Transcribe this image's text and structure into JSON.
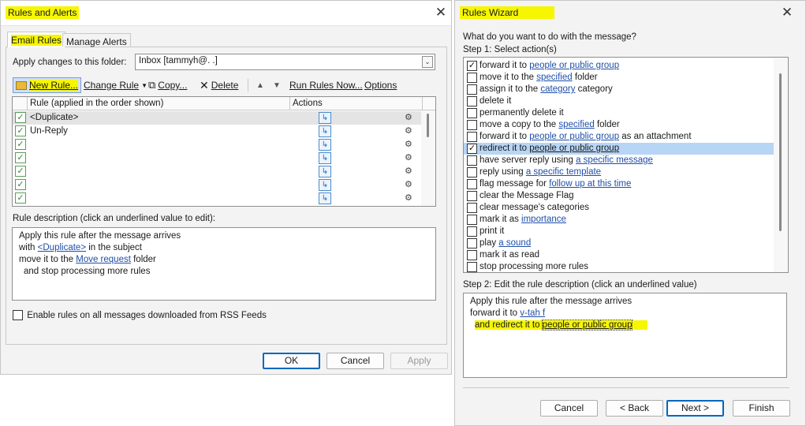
{
  "rules_alerts": {
    "title": "Rules and Alerts",
    "tabs": [
      "Email Rules",
      "Manage Alerts"
    ],
    "apply_folder_label": "Apply changes to this folder:",
    "folder_value": "Inbox [tammyh@.                    .]",
    "toolbar": {
      "new_rule": "New Rule...",
      "change_rule": "Change Rule",
      "copy": "Copy...",
      "delete": "Delete",
      "run_rules": "Run Rules Now...",
      "options": "Options"
    },
    "table": {
      "col_rule": "Rule (applied in the order shown)",
      "col_actions": "Actions",
      "rows": [
        "<Duplicate>",
        "Un-Reply",
        "",
        "",
        "",
        "",
        ""
      ]
    },
    "desc_label": "Rule description (click an underlined value to edit):",
    "desc": {
      "line1": "Apply this rule after the message arrives",
      "line2_pre": "with ",
      "line2_link": "<Duplicate>",
      "line2_post": " in the subject",
      "line3_pre": "move it to the ",
      "line3_link": "Move request",
      "line3_post": " folder",
      "line4": "and stop processing more rules"
    },
    "rss_label": "Enable rules on all messages downloaded from RSS Feeds",
    "buttons": {
      "ok": "OK",
      "cancel": "Cancel",
      "apply": "Apply"
    }
  },
  "rules_wizard": {
    "title": "Rules Wizard",
    "question": "What do you want to do with the message?",
    "step1": "Step 1: Select action(s)",
    "actions": [
      {
        "checked": true,
        "pre": "forward it to ",
        "link": "people or public group",
        "post": ""
      },
      {
        "checked": false,
        "pre": "move it to the ",
        "link": "specified",
        "post": " folder"
      },
      {
        "checked": false,
        "pre": "assign it to the ",
        "link": "category",
        "post": " category"
      },
      {
        "checked": false,
        "pre": "delete it",
        "link": "",
        "post": ""
      },
      {
        "checked": false,
        "pre": "permanently delete it",
        "link": "",
        "post": ""
      },
      {
        "checked": false,
        "pre": "move a copy to the ",
        "link": "specified",
        "post": " folder"
      },
      {
        "checked": false,
        "pre": "forward it to ",
        "link": "people or public group",
        "post": " as an attachment"
      },
      {
        "checked": true,
        "pre": "redirect it to ",
        "link": "people or public group",
        "post": ""
      },
      {
        "checked": false,
        "pre": "have server reply using ",
        "link": "a specific message",
        "post": ""
      },
      {
        "checked": false,
        "pre": "reply using ",
        "link": "a specific template",
        "post": ""
      },
      {
        "checked": false,
        "pre": "flag message for ",
        "link": "follow up at this time",
        "post": ""
      },
      {
        "checked": false,
        "pre": "clear the Message Flag",
        "link": "",
        "post": ""
      },
      {
        "checked": false,
        "pre": "clear message's categories",
        "link": "",
        "post": ""
      },
      {
        "checked": false,
        "pre": "mark it as ",
        "link": "importance",
        "post": ""
      },
      {
        "checked": false,
        "pre": "print it",
        "link": "",
        "post": ""
      },
      {
        "checked": false,
        "pre": "play ",
        "link": "a sound",
        "post": ""
      },
      {
        "checked": false,
        "pre": "mark it as read",
        "link": "",
        "post": ""
      },
      {
        "checked": false,
        "pre": "stop processing more rules",
        "link": "",
        "post": ""
      }
    ],
    "step2": "Step 2: Edit the rule description (click an underlined value)",
    "desc": {
      "line1": "Apply this rule after the message arrives",
      "line2_pre": "forward it to ",
      "line2_link": "v-tah     f",
      "line3_pre": "and redirect it to ",
      "line3_link": "people or public group"
    },
    "buttons": {
      "cancel": "Cancel",
      "back": "< Back",
      "next": "Next >",
      "finish": "Finish"
    }
  }
}
